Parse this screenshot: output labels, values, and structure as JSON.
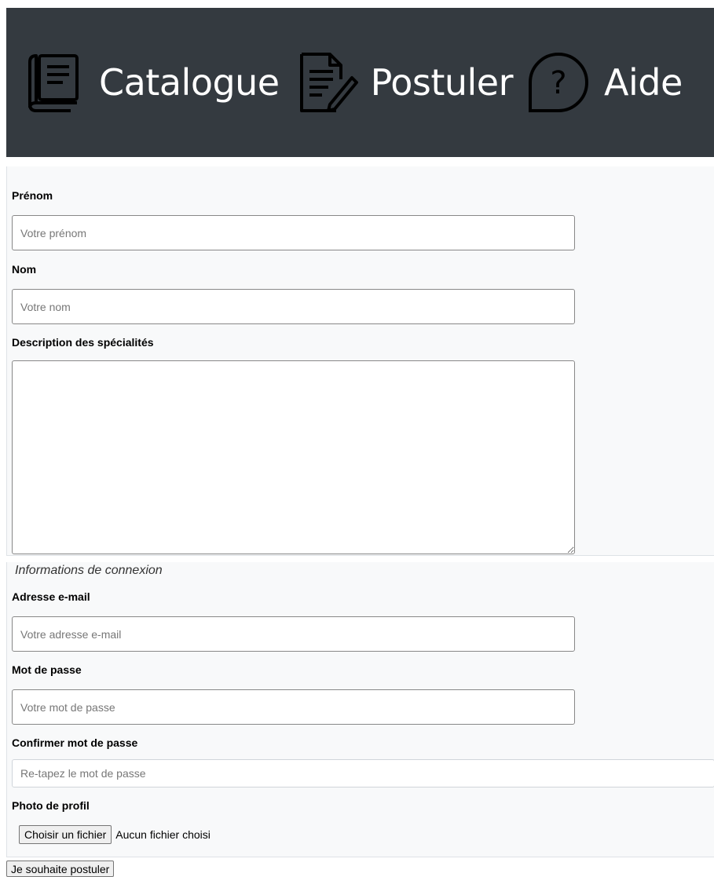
{
  "navbar": {
    "items": [
      {
        "label": "Catalogue",
        "icon": "catalogue-book-icon"
      },
      {
        "label": "Postuler",
        "icon": "document-pen-icon"
      },
      {
        "label": "Aide",
        "icon": "question-bubble-icon"
      }
    ],
    "background": "#343a40"
  },
  "personal": {
    "firstname_label": "Prénom",
    "firstname_placeholder": "Votre prénom",
    "lastname_label": "Nom",
    "lastname_placeholder": "Votre nom",
    "description_label": "Description des spécialités"
  },
  "login": {
    "legend": "Informations de connexion",
    "email_label": "Adresse e-mail",
    "email_placeholder": "Votre adresse e-mail",
    "password_label": "Mot de passe",
    "password_placeholder": "Votre mot de passe",
    "confirm_label": "Confirmer mot de passe",
    "confirm_placeholder": "Re-tapez le mot de passe",
    "photo_label": "Photo de profil",
    "file_button": "Choisir un fichier",
    "file_status": "Aucun fichier choisi"
  },
  "submit_label": "Je souhaite postuler"
}
